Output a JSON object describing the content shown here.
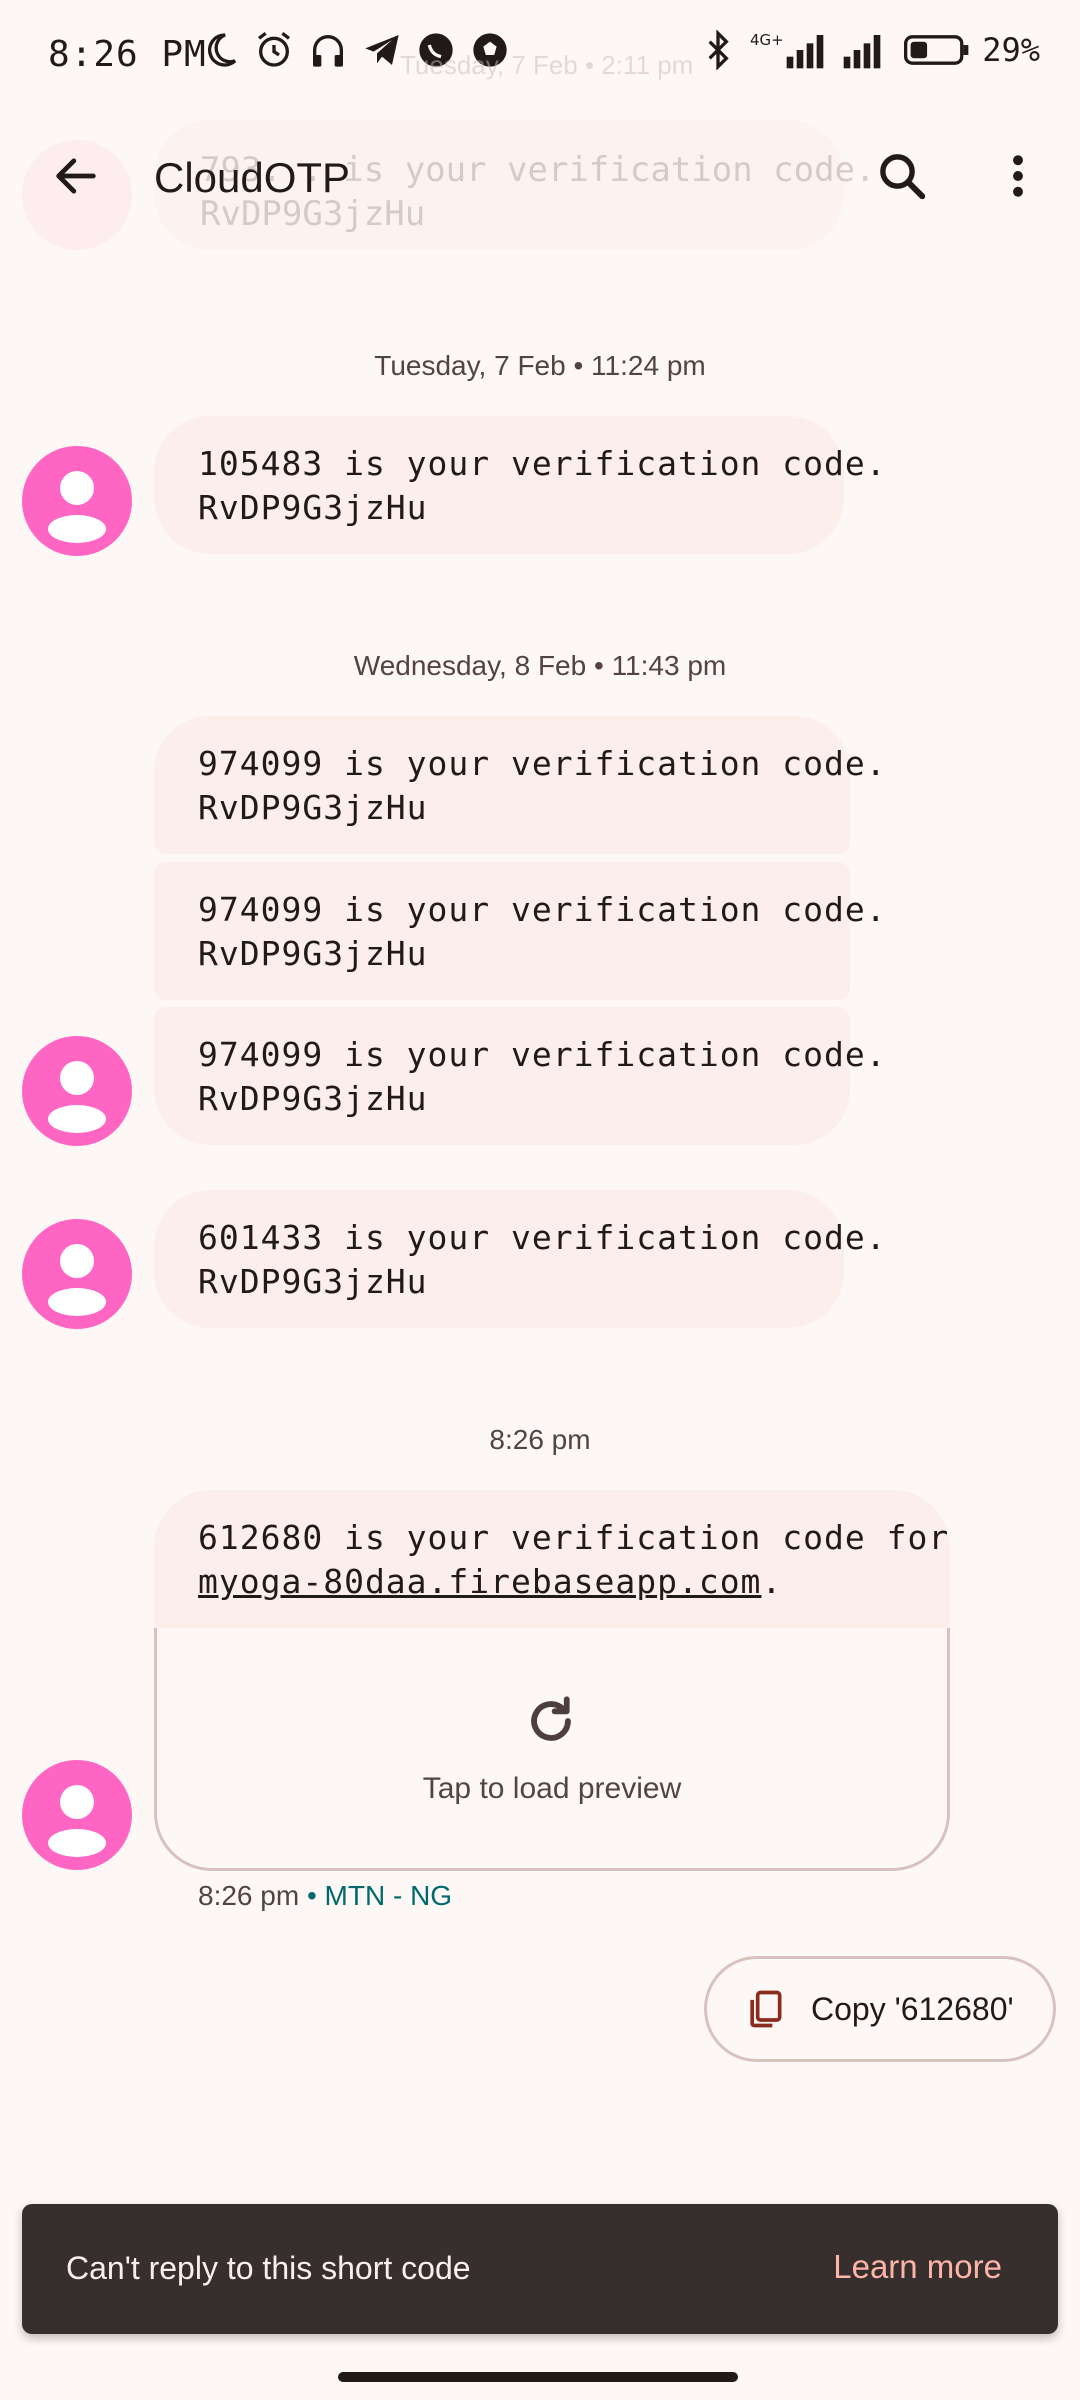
{
  "status_bar": {
    "time": "8:26 PM",
    "battery": "29%"
  },
  "ghost": {
    "date": "Tuesday, 7 Feb • 2:11 pm",
    "text": "793... is your verification code.\nRvDP9G3jzHu"
  },
  "toolbar": {
    "title": "CloudOTP"
  },
  "conversation": {
    "sep1": "Tuesday, 7 Feb • 11:24 pm",
    "msg1": "105483 is your verification code.\nRvDP9G3jzHu",
    "sep2": "Wednesday, 8 Feb • 11:43 pm",
    "msg2": "974099 is your verification code.\nRvDP9G3jzHu",
    "msg3": "974099 is your verification code.\nRvDP9G3jzHu",
    "msg4": "974099 is your verification code.\nRvDP9G3jzHu",
    "msg5": "601433 is your verification code.\nRvDP9G3jzHu",
    "sep3": "8:26 pm",
    "msg6_line1": "612680 is your verification code for",
    "msg6_link": "myoga-80daa.firebaseapp.com",
    "msg6_tail": ".",
    "preview_label": "Tap to load preview",
    "meta_time": "8:26 pm",
    "meta_carrier": " • MTN - NG"
  },
  "copy_chip": {
    "label": "Copy '612680'"
  },
  "snackbar": {
    "text": "Can't reply to this short code",
    "action": "Learn more"
  },
  "colors": {
    "background": "#fdf8f6",
    "bubble": "#fbeeeb",
    "avatar": "#ff66c4",
    "carrier": "#00696e",
    "snackbar": "#362f2e",
    "snackbar_action": "#ffb4a8"
  },
  "icons": [
    "back-arrow-icon",
    "search-icon",
    "more-vert-icon",
    "person-icon",
    "refresh-icon",
    "copy-icon"
  ]
}
